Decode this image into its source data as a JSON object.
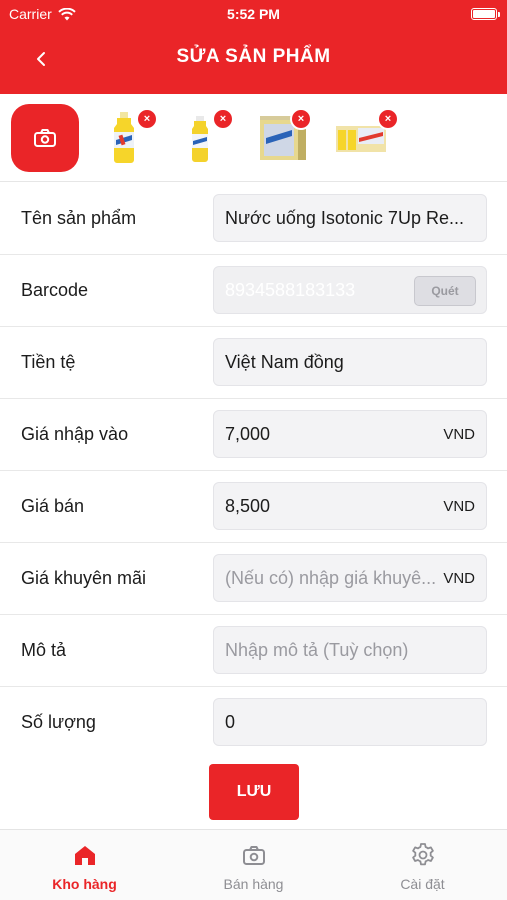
{
  "status_bar": {
    "carrier": "Carrier",
    "time": "5:52 PM"
  },
  "header": {
    "title": "SỬA SẢN PHẨM"
  },
  "images": {
    "remove_label": "×",
    "thumbnails": [
      "7Up Revive bottle",
      "7Up Revive bottle",
      "7Up Revive carton",
      "7Up Revive pack"
    ]
  },
  "form": {
    "name": {
      "label": "Tên sản phẩm",
      "value": "Nước uống Isotonic 7Up Re..."
    },
    "barcode": {
      "label": "Barcode",
      "value": "8934588183133",
      "scan_label": "Quét"
    },
    "currency": {
      "label": "Tiền tệ",
      "value": "Việt Nam đồng"
    },
    "import_price": {
      "label": "Giá nhập vào",
      "value": "7,000",
      "unit": "VND"
    },
    "sale_price": {
      "label": "Giá bán",
      "value": "8,500",
      "unit": "VND"
    },
    "promo_price": {
      "label": "Giá khuyên mãi",
      "placeholder": "(Nếu có) nhập giá khuyê...",
      "unit": "VND"
    },
    "description": {
      "label": "Mô tả",
      "placeholder": "Nhập mô tả (Tuỳ chọn)"
    },
    "quantity": {
      "label": "Số lượng",
      "value": "0"
    }
  },
  "save_label": "LƯU",
  "tabbar": {
    "tabs": [
      {
        "label": "Kho hàng",
        "icon": "home-icon",
        "active": true
      },
      {
        "label": "Bán hàng",
        "icon": "camera-icon",
        "active": false
      },
      {
        "label": "Cài đặt",
        "icon": "gear-icon",
        "active": false
      }
    ]
  },
  "colors": {
    "accent": "#ea2528",
    "field_bg": "#f3f3f5",
    "inactive": "#8e8e93"
  }
}
